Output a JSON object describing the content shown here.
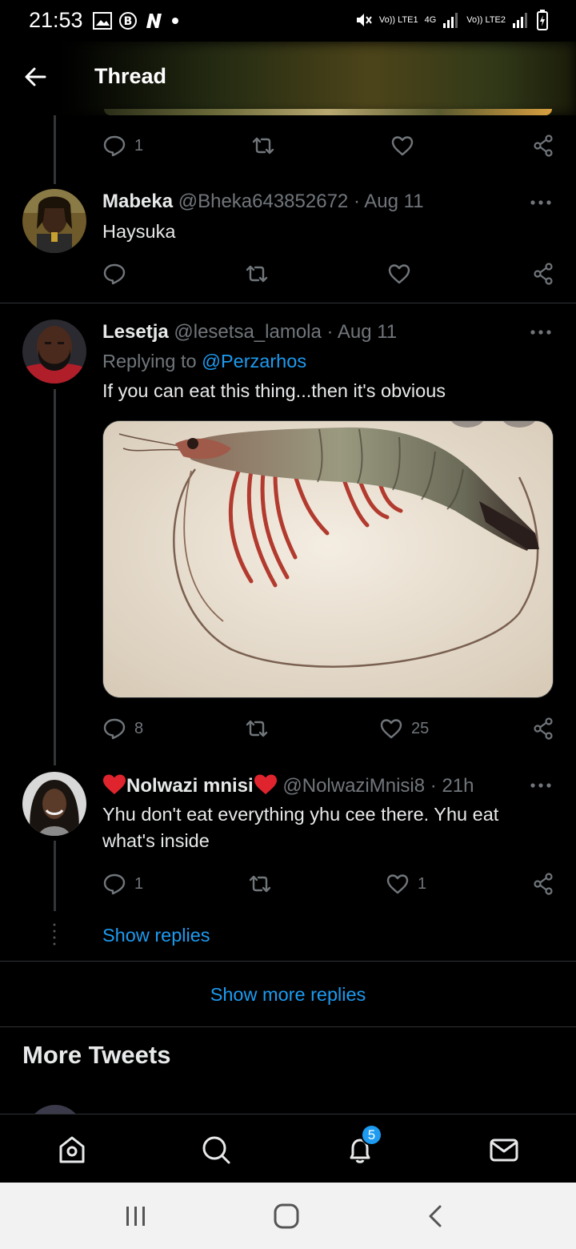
{
  "status_bar": {
    "time": "21:53",
    "network1": "Vo)) LTE1",
    "network2": "4G",
    "network3": "Vo)) LTE2"
  },
  "header": {
    "title": "Thread"
  },
  "tweets": [
    {
      "reply_count": "1",
      "like_count": "",
      "retweet_count": ""
    },
    {
      "name": "Mabeka",
      "handle": "@Bheka643852672",
      "date": "· Aug 11",
      "text": "Haysuka",
      "reply_count": "",
      "like_count": ""
    },
    {
      "name": "Lesetja",
      "handle": "@lesetsa_lamola",
      "date": "· Aug 11",
      "replying_prefix": "Replying to",
      "replying_to": "@Perzarhos",
      "text": "If you can eat this thing...then it's obvious",
      "reply_count": "8",
      "like_count": "25"
    },
    {
      "name": "Nolwazi mnisi",
      "handle": "@NolwaziMnisi8",
      "date": "· 21h",
      "text": "Yhu don't eat everything yhu cee there. Yhu eat what's inside",
      "reply_count": "1",
      "like_count": "1"
    }
  ],
  "show_replies": "Show replies",
  "show_more_replies": "Show more replies",
  "more_tweets_heading": "More Tweets",
  "bottom_nav": {
    "notifications_badge": "5"
  },
  "colors": {
    "accent": "#1d9bf0",
    "muted": "#71767b",
    "background": "#000000"
  }
}
